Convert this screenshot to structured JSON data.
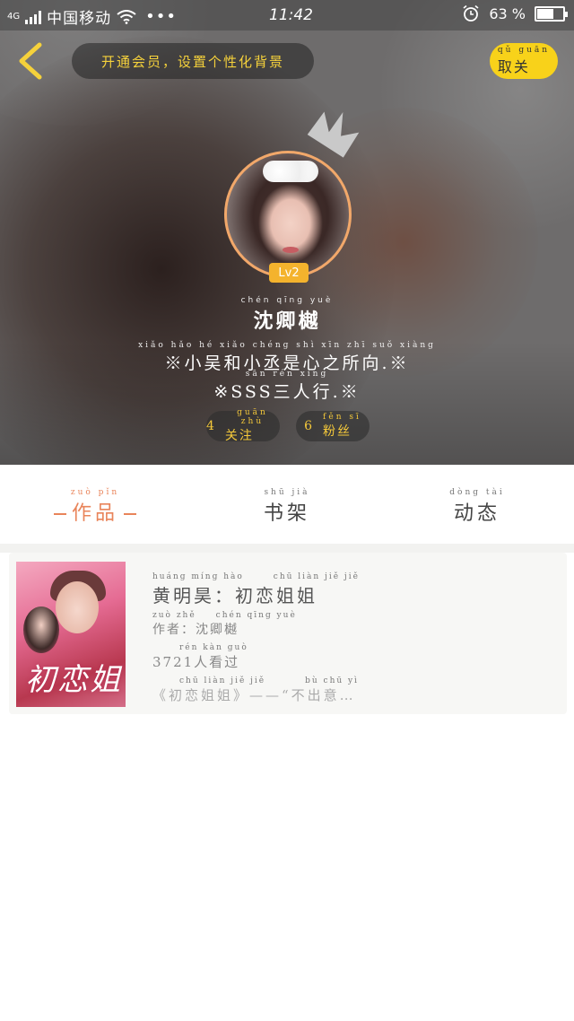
{
  "status_bar": {
    "network": "4G",
    "carrier": "中国移动",
    "dots": "•••",
    "time": "11:42",
    "battery_percent": "63 %",
    "battery_level": 0.63
  },
  "header": {
    "vip_banner": "开通会员，设置个性化背景",
    "unfollow_button": "取关",
    "unfollow_pinyin": "qǔ guān"
  },
  "profile": {
    "level": "Lv2",
    "name": "沈卿樾",
    "name_pinyin": "chén qīng yuè",
    "bio_line1": "※小吴和小丞是心之所向.※",
    "bio_line1_pinyin": "xiǎo hǎo hé xiǎo chéng shì xīn zhī suǒ xiàng",
    "bio_line2": "※SSS三人行.※",
    "bio_line2_pinyin": "sān rén xíng",
    "following_count": "4",
    "following_label": "关注",
    "following_pinyin": "guān zhù",
    "fans_count": "6",
    "fans_label": "粉丝",
    "fans_pinyin": "fěn sī"
  },
  "tabs": [
    {
      "label": "作品",
      "pinyin": "zuò pǐn",
      "active": true
    },
    {
      "label": "书架",
      "pinyin": "shū jià",
      "active": false
    },
    {
      "label": "动态",
      "pinyin": "dòng tài",
      "active": false
    }
  ],
  "works": [
    {
      "title": "黄明昊：初恋姐姐",
      "title_pinyin": "huáng míng hào　　　chū liàn jiě jiě",
      "author": "作者：沈卿樾",
      "author_pinyin": "zuò zhě　　chén qīng yuè",
      "views": "3721人看过",
      "views_pinyin": "rén kàn guò",
      "excerpt": "《初恋姐姐》——“不出意…",
      "excerpt_pinyin": "chū liàn jiě jiě　　　　bù chū yì",
      "cover_text": "初恋姐"
    }
  ],
  "colors": {
    "accent_yellow": "#f8d21a",
    "accent_orange": "#e9845a",
    "level_badge": "#f4b32d"
  },
  "icons": {
    "back": "chevron-left-icon",
    "crown": "crown-icon",
    "alarm": "alarm-clock-icon",
    "battery": "battery-icon",
    "wifi": "wifi-icon",
    "signal": "signal-icon"
  }
}
